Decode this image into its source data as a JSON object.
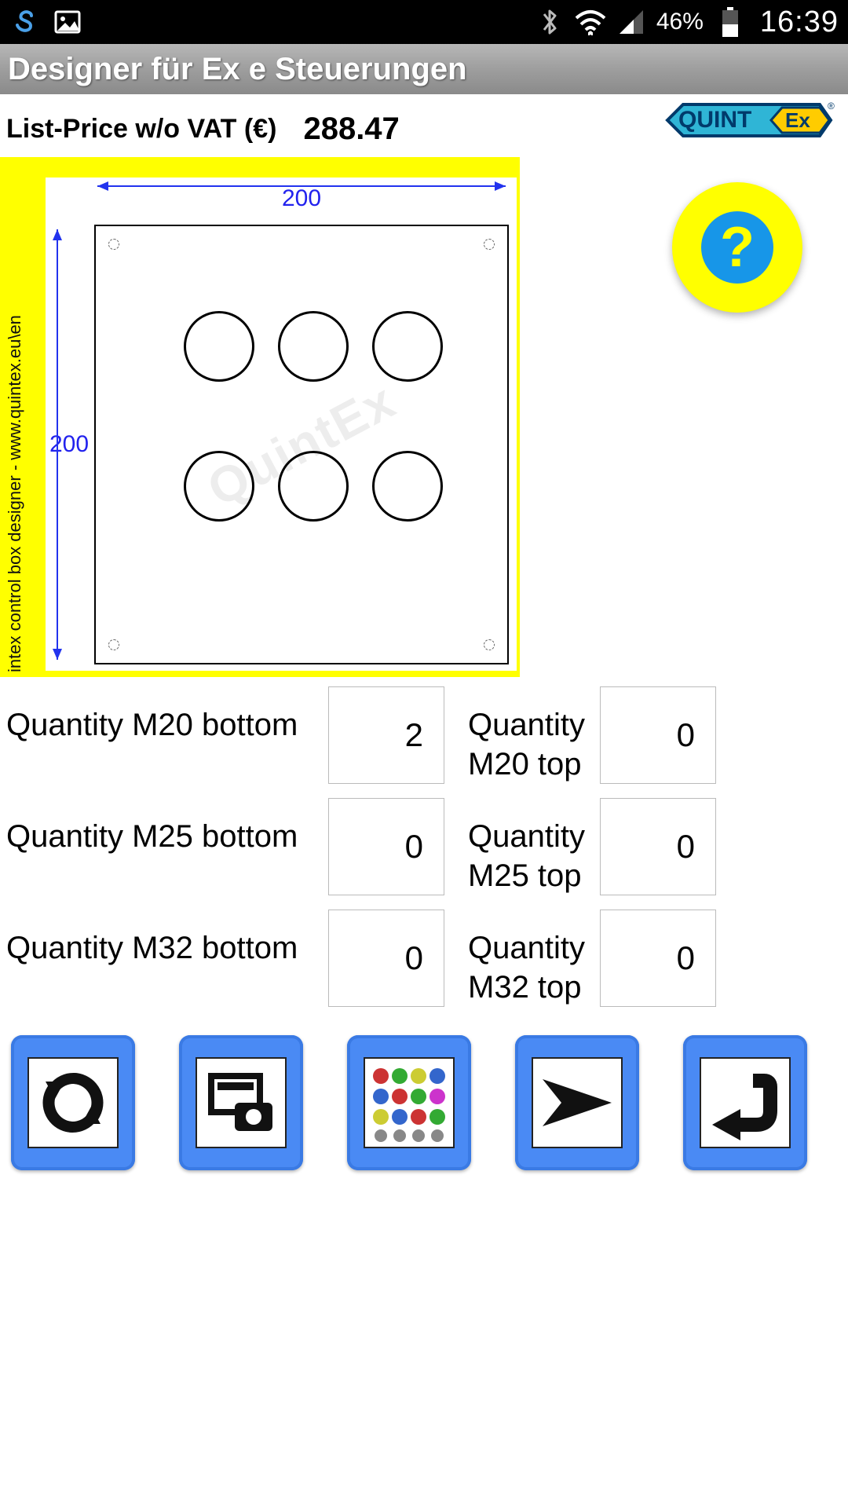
{
  "status": {
    "battery_pct": "46%",
    "clock": "16:39"
  },
  "title": "Designer für Ex e Steuerungen",
  "price": {
    "label": "List-Price w/o VAT (€)",
    "value": "288.47"
  },
  "logo": {
    "text": "QUINT",
    "badge": "Ex"
  },
  "diagram": {
    "width_label": "200",
    "height_label": "200",
    "side_text": "intex control box designer -  www.quintex.eu\\en",
    "watermark": "QuintEx"
  },
  "help": {
    "symbol": "?"
  },
  "quantities": {
    "m20_bottom": {
      "label": "Quantity M20 bottom",
      "value": "2"
    },
    "m20_top": {
      "label": "Quantity M20 top",
      "value": "0"
    },
    "m25_bottom": {
      "label": "Quantity M25 bottom",
      "value": "0"
    },
    "m25_top": {
      "label": "Quantity M25 top",
      "value": "0"
    },
    "m32_bottom": {
      "label": "Quantity M32 bottom",
      "value": "0"
    },
    "m32_top": {
      "label": "Quantity M32 top",
      "value": "0"
    }
  },
  "buttons": {
    "refresh": "refresh",
    "screenshot": "screenshot",
    "palette": "components",
    "send": "send",
    "back": "back"
  }
}
